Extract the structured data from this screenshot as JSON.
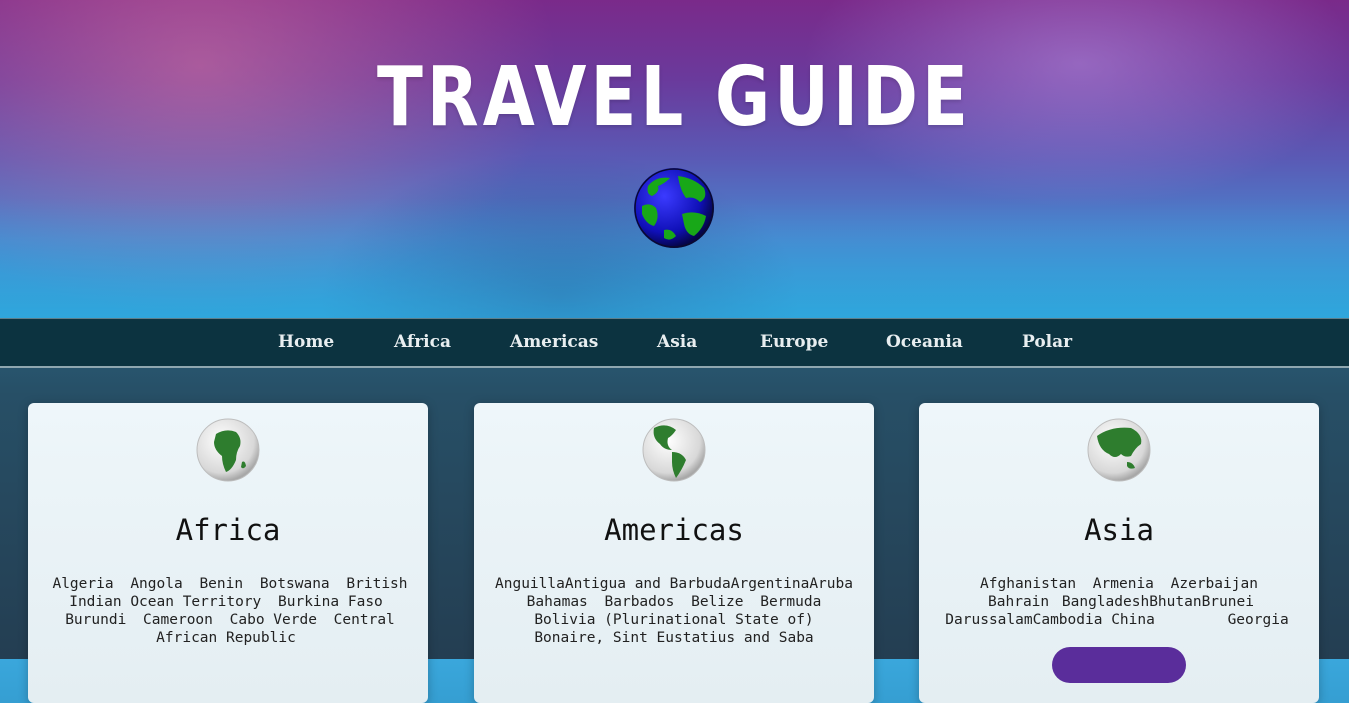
{
  "header": {
    "title": "TRAVEL GUIDE",
    "globe_icon": "globe-icon"
  },
  "nav": {
    "items": [
      "Home",
      "Africa",
      "Americas",
      "Asia",
      "Europe",
      "Oceania",
      "Polar"
    ]
  },
  "cards": [
    {
      "title": "Africa",
      "icon": "africa-globe-icon",
      "countries": [
        "Algeria",
        "Angola",
        "Benin",
        "Botswana",
        "British Indian Ocean Territory",
        "Burkina Faso",
        "Burundi",
        "Cameroon",
        "Cabo Verde",
        "Central African Republic"
      ]
    },
    {
      "title": "Americas",
      "icon": "americas-globe-icon",
      "countries": [
        "Anguilla",
        "Antigua and Barbuda",
        "Argentina",
        "Aruba",
        "Bahamas",
        "Barbados",
        "Belize",
        "Bermuda",
        "Bolivia (Plurinational State of)",
        "Bonaire, Sint Eustatius and Saba"
      ]
    },
    {
      "title": "Asia",
      "icon": "asia-globe-icon",
      "countries": [
        "Afghanistan",
        "Armenia",
        "Azerbaijan",
        "Bahrain",
        "Bangladesh",
        "Bhutan",
        "Brunei Darussalam",
        "Cambodia",
        "China",
        "Georgia"
      ]
    }
  ],
  "colors": {
    "nav_bg": "#0c3340",
    "button_bg": "#5a2d9b",
    "hero_top": "#7a2a8a",
    "hero_bottom": "#2fa6dc"
  }
}
